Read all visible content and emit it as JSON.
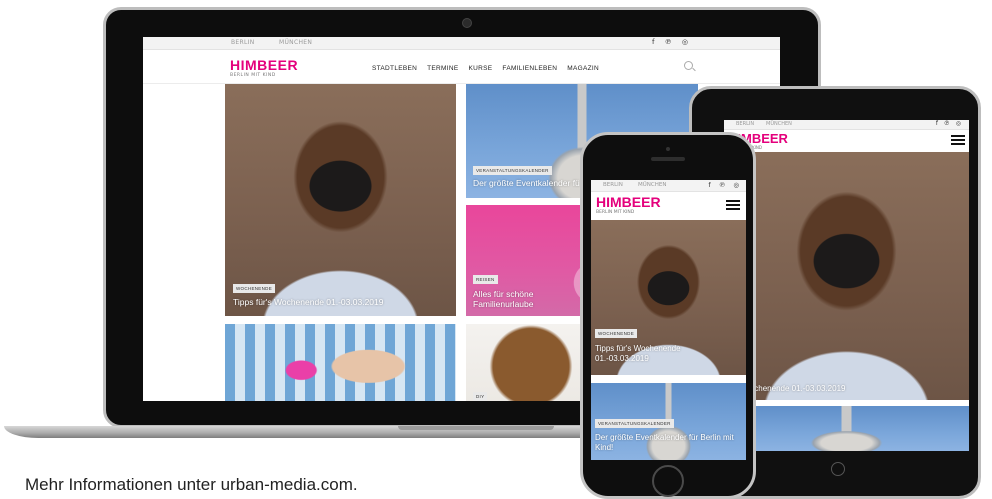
{
  "site": {
    "logo": "HIMBEER",
    "logo_sub": "BERLIN MIT KIND",
    "cities": [
      "BERLIN",
      "MÜNCHEN"
    ],
    "social_icons": [
      "facebook-icon",
      "pinterest-icon",
      "instagram-icon"
    ],
    "social_glyphs": "f ℗ ◎",
    "accent": "#e4007c"
  },
  "laptop": {
    "nav": [
      "STADTLEBEN",
      "TERMINE",
      "KURSE",
      "FAMILIENLEBEN",
      "MAGAZIN"
    ],
    "cards": [
      {
        "tag": "WOCHENENDE",
        "caption": "Tipps für's Wochenende 01.-03.03.2019"
      },
      {
        "tag": "VERANSTALTUNGSKALENDER",
        "caption": "Der größte Eventkalender fü"
      },
      {
        "tag": "REISEN",
        "caption": "Alles für schöne Familienurlaube"
      },
      {
        "tag": "DIY",
        "caption": ""
      }
    ]
  },
  "tablet": {
    "caption": "r's Wochenende 01.-03.03.2019"
  },
  "phone": {
    "cards": [
      {
        "tag": "WOCHENENDE",
        "caption": "Tipps für's Wochenende 01.-03.03.2019"
      },
      {
        "tag": "VERANSTALTUNGSKALENDER",
        "caption": "Der größte Eventkalender für Berlin mit Kind!"
      }
    ]
  },
  "footer": {
    "text": "Mehr Informationen unter urban-media.com."
  }
}
